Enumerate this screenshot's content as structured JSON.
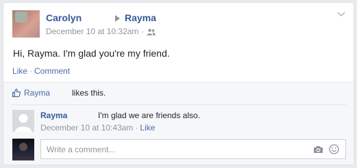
{
  "post": {
    "author": "Carolyn",
    "target": "Rayma",
    "timestamp": "December 10 at 10:32am",
    "audience_icon": "friends-icon",
    "menu_icon": "chevron-down-icon",
    "text": "Hi, Rayma. I'm glad you're my friend.",
    "actions": {
      "like": "Like",
      "separator": "·",
      "comment": "Comment"
    }
  },
  "likes": {
    "icon": "thumbs-up-icon",
    "liker": "Rayma",
    "text": "likes this."
  },
  "comment": {
    "author": "Rayma",
    "text": "I'm glad we are friends also.",
    "timestamp": "December 10 at 10:43am",
    "separator": "·",
    "like": "Like"
  },
  "composer": {
    "placeholder": "Write a comment...",
    "icons": [
      "camera-icon",
      "smile-icon"
    ]
  },
  "colors": {
    "link": "#365899",
    "meta": "#90949c",
    "text": "#1d2129",
    "feedback_bg": "#f6f7f9"
  }
}
